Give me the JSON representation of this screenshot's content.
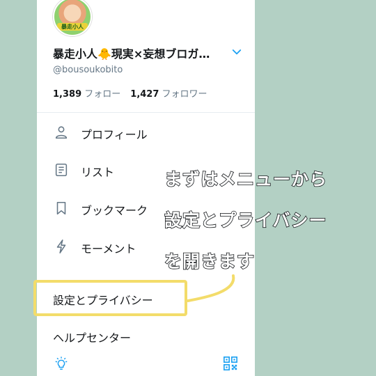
{
  "profile": {
    "display_name": "暴走小人🐥現実×妄想ブロガ…",
    "handle": "@bousoukobito",
    "following_count": "1,389",
    "following_label": "フォロー",
    "followers_count": "1,427",
    "followers_label": "フォロワー",
    "avatar_text": "暴走小人"
  },
  "menu": {
    "items": [
      {
        "label": "プロフィール",
        "icon": "person-icon"
      },
      {
        "label": "リスト",
        "icon": "list-icon"
      },
      {
        "label": "ブックマーク",
        "icon": "bookmark-icon"
      },
      {
        "label": "モーメント",
        "icon": "lightning-icon"
      }
    ],
    "settings_label": "設定とプライバシー",
    "help_label": "ヘルプセンター"
  },
  "footer": {
    "left_icon": "bulb-icon",
    "right_icon": "qr-code-icon"
  },
  "annotation": {
    "lines": [
      "まずはメニューから",
      "設定とプライバシー",
      "を開きます"
    ],
    "highlight_color": "#f3dc6a"
  },
  "colors": {
    "background": "#b3d0c4",
    "accent": "#1da1f2",
    "text": "#14171a",
    "muted": "#657786"
  }
}
